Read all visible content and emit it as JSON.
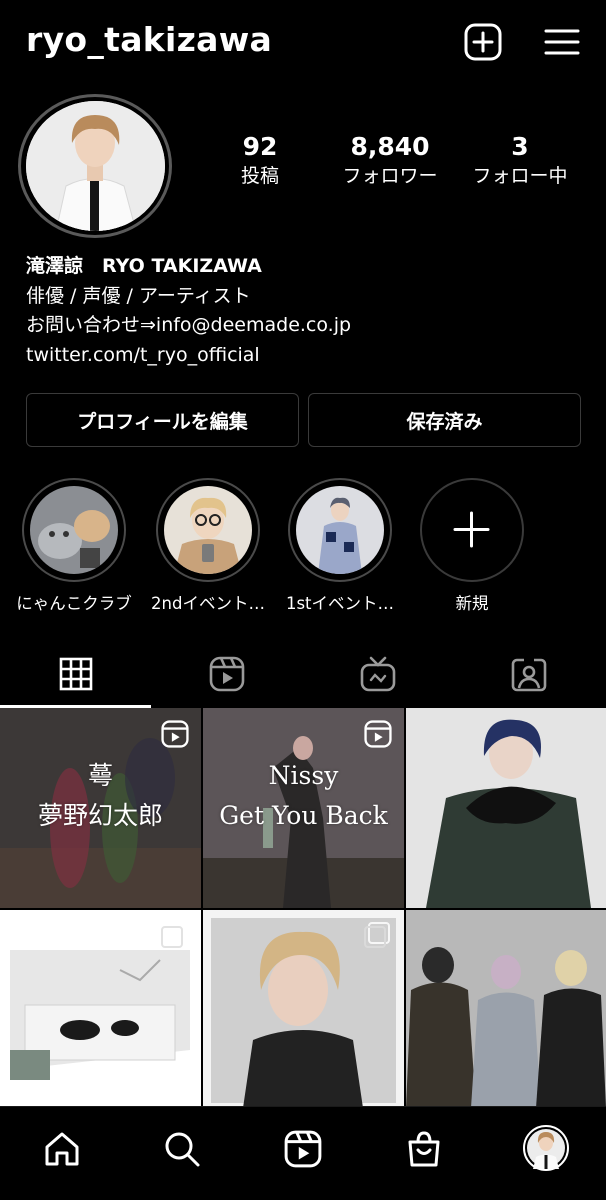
{
  "header": {
    "username": "ryo_takizawa",
    "icons": [
      "add-post-icon",
      "menu-icon"
    ]
  },
  "stats": [
    {
      "value": "92",
      "label": "投稿"
    },
    {
      "value": "8,840",
      "label": "フォロワー"
    },
    {
      "value": "3",
      "label": "フォロー中"
    }
  ],
  "bio": {
    "name": "滝澤諒　RYO TAKIZAWA",
    "line1": "俳優 / 声優 / アーティスト",
    "line2": "お問い合わせ⇒info@deemade.co.jp",
    "link": "twitter.com/t_ryo_official"
  },
  "buttons": {
    "edit_profile": "プロフィールを編集",
    "saved": "保存済み"
  },
  "highlights": [
    {
      "label": "にゃんこクラブ"
    },
    {
      "label": "2ndイベント…"
    },
    {
      "label": "1stイベント…"
    },
    {
      "label": "新規"
    }
  ],
  "tabs": [
    "grid-icon",
    "reels-icon",
    "igtv-icon",
    "tagged-icon"
  ],
  "posts": [
    {
      "line1": "蕚",
      "line2": "夢野幻太郎",
      "reel": true
    },
    {
      "line1": "Nissy",
      "line2": "Get You Back",
      "reel": true
    },
    {
      "line1": "",
      "line2": "",
      "reel": false
    },
    {
      "line1": "",
      "line2": "",
      "reel": false
    },
    {
      "line1": "",
      "line2": "",
      "reel": false
    },
    {
      "line1": "",
      "line2": "",
      "reel": false
    }
  ],
  "bottom_nav": [
    "home-icon",
    "search-icon",
    "reels-icon",
    "shop-icon",
    "profile-avatar"
  ],
  "colors": {
    "background": "#000000",
    "text": "#ffffff",
    "border": "#3a3a3a"
  }
}
